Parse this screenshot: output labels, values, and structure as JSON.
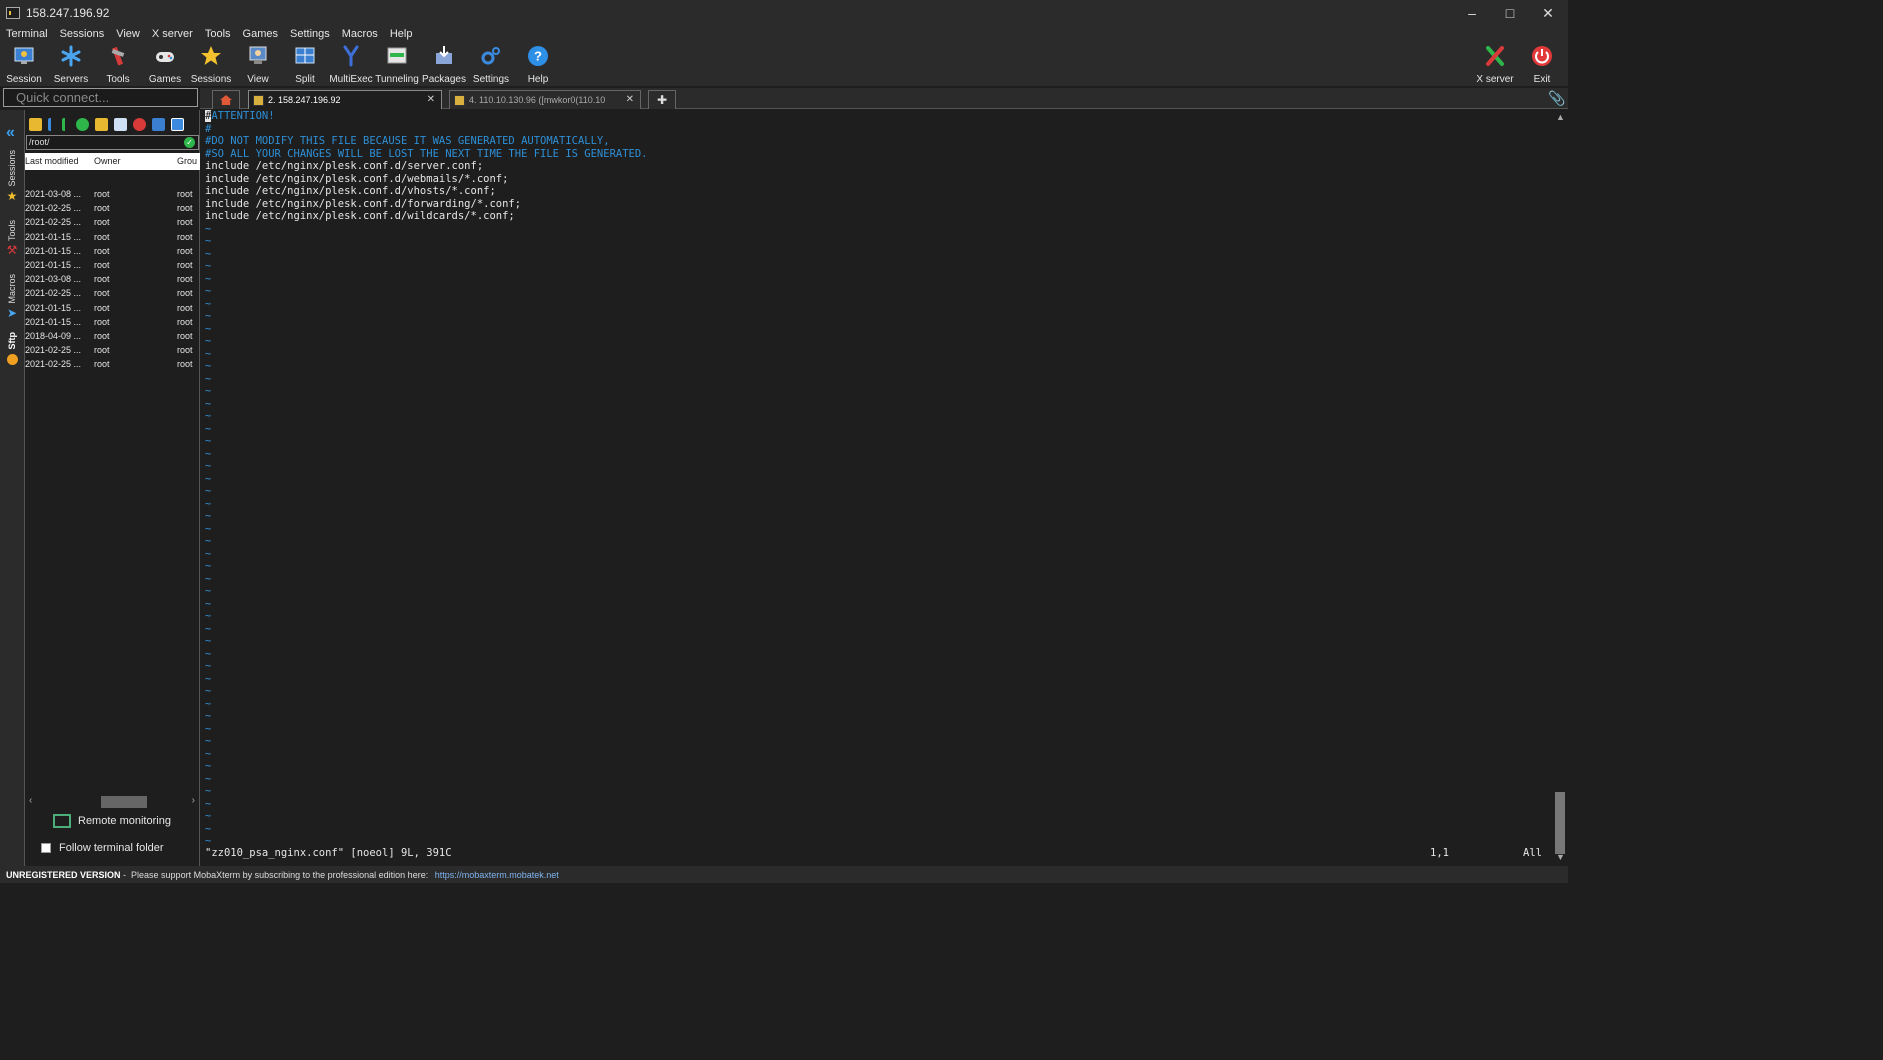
{
  "window": {
    "title": "158.247.196.92"
  },
  "menu": [
    "Terminal",
    "Sessions",
    "View",
    "X server",
    "Tools",
    "Games",
    "Settings",
    "Macros",
    "Help"
  ],
  "toolbar": {
    "left": [
      {
        "label": "Session",
        "icon": "session-icon"
      },
      {
        "label": "Servers",
        "icon": "servers-icon"
      },
      {
        "label": "Tools",
        "icon": "tools-icon"
      },
      {
        "label": "Games",
        "icon": "games-icon"
      },
      {
        "label": "Sessions",
        "icon": "star-icon"
      },
      {
        "label": "View",
        "icon": "view-icon"
      },
      {
        "label": "Split",
        "icon": "split-icon"
      },
      {
        "label": "MultiExec",
        "icon": "multiexec-icon"
      },
      {
        "label": "Tunneling",
        "icon": "tunneling-icon"
      },
      {
        "label": "Packages",
        "icon": "packages-icon"
      },
      {
        "label": "Settings",
        "icon": "settings-icon"
      },
      {
        "label": "Help",
        "icon": "help-icon"
      }
    ],
    "right": [
      {
        "label": "X server",
        "icon": "xserver-icon"
      },
      {
        "label": "Exit",
        "icon": "power-icon"
      }
    ]
  },
  "quick_connect": {
    "placeholder": "Quick connect..."
  },
  "tabs": [
    {
      "label": "2. 158.247.196.92",
      "active": true
    },
    {
      "label": "4. 110.10.130.96 ([mwkor0(110.10",
      "active": false
    }
  ],
  "side_tabs": [
    "Sessions",
    "Tools",
    "Macros",
    "Sftp"
  ],
  "sftp": {
    "path": "/root/",
    "columns": [
      "Last modified",
      "Owner",
      "Grou"
    ],
    "rows": [
      {
        "modified": "2021-03-08 ...",
        "owner": "root",
        "group": "root"
      },
      {
        "modified": "2021-02-25 ...",
        "owner": "root",
        "group": "root"
      },
      {
        "modified": "2021-02-25 ...",
        "owner": "root",
        "group": "root"
      },
      {
        "modified": "2021-01-15 ...",
        "owner": "root",
        "group": "root"
      },
      {
        "modified": "2021-01-15 ...",
        "owner": "root",
        "group": "root"
      },
      {
        "modified": "2021-01-15 ...",
        "owner": "root",
        "group": "root"
      },
      {
        "modified": "2021-03-08 ...",
        "owner": "root",
        "group": "root"
      },
      {
        "modified": "2021-02-25 ...",
        "owner": "root",
        "group": "root"
      },
      {
        "modified": "2021-01-15 ...",
        "owner": "root",
        "group": "root"
      },
      {
        "modified": "2021-01-15 ...",
        "owner": "root",
        "group": "root"
      },
      {
        "modified": "2018-04-09 ...",
        "owner": "root",
        "group": "root"
      },
      {
        "modified": "2021-02-25 ...",
        "owner": "root",
        "group": "root"
      },
      {
        "modified": "2021-02-25 ...",
        "owner": "root",
        "group": "root"
      }
    ],
    "remote_monitoring": "Remote monitoring",
    "follow_folder": "Follow terminal folder"
  },
  "terminal": {
    "lines": [
      {
        "text": "ATTENTION!",
        "cursor": "#",
        "kind": "comment"
      },
      {
        "text": "#",
        "kind": "comment"
      },
      {
        "text": "#DO NOT MODIFY THIS FILE BECAUSE IT WAS GENERATED AUTOMATICALLY,",
        "kind": "comment"
      },
      {
        "text": "#SO ALL YOUR CHANGES WILL BE LOST THE NEXT TIME THE FILE IS GENERATED.",
        "kind": "comment"
      },
      {
        "text": "include /etc/nginx/plesk.conf.d/server.conf;",
        "kind": "text"
      },
      {
        "text": "include /etc/nginx/plesk.conf.d/webmails/*.conf;",
        "kind": "text"
      },
      {
        "text": "include /etc/nginx/plesk.conf.d/vhosts/*.conf;",
        "kind": "text"
      },
      {
        "text": "include /etc/nginx/plesk.conf.d/forwarding/*.conf;",
        "kind": "text"
      },
      {
        "text": "include /etc/nginx/plesk.conf.d/wildcards/*.conf;",
        "kind": "text"
      }
    ],
    "tilde_count": 50,
    "tilde": "~",
    "status_file": "\"zz010_psa_nginx.conf\" [noeol] 9L, 391C",
    "status_pos": "1,1",
    "status_all": "All"
  },
  "footer": {
    "version": "UNREGISTERED VERSION",
    "message": " -  Please support MobaXterm by subscribing to the professional edition here: ",
    "link": "https://mobaxterm.mobatek.net"
  },
  "colors": {
    "accent": "#2e8fd6",
    "background": "#1e1e1e",
    "chrome": "#2b2b2b"
  }
}
